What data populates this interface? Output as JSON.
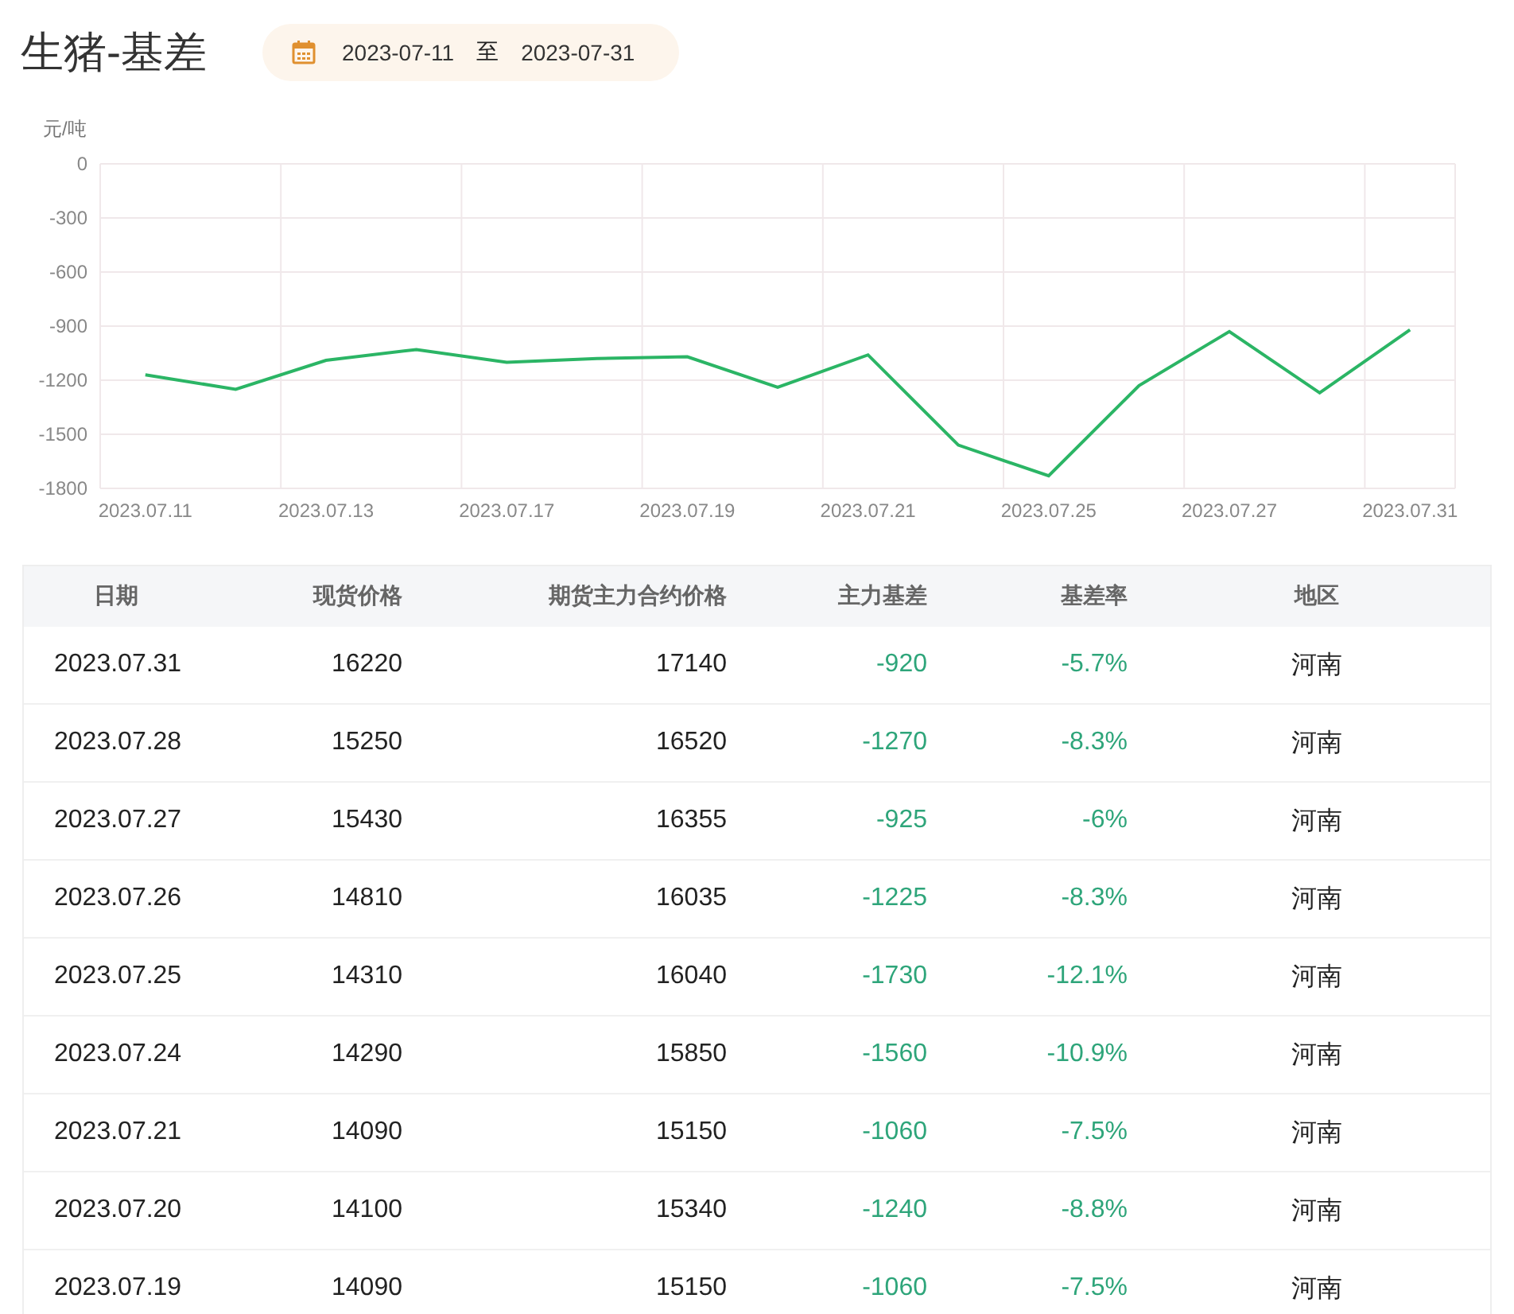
{
  "title": "生猪-基差",
  "date_range": {
    "start": "2023-07-11",
    "separator": "至",
    "end": "2023-07-31"
  },
  "chart": {
    "chart_data": {
      "type": "line",
      "ylabel": "元/吨",
      "categories": [
        "2023.07.11",
        null,
        "2023.07.13",
        null,
        "2023.07.17",
        null,
        "2023.07.19",
        null,
        "2023.07.21",
        null,
        "2023.07.25",
        null,
        "2023.07.27",
        null,
        "2023.07.31"
      ],
      "series": [
        {
          "color": "#2bb565",
          "values": [
            -1170,
            -1250,
            -1090,
            -1030,
            -1100,
            -1080,
            -1070,
            -1240,
            -1060,
            -1560,
            -1730,
            -1230,
            -930,
            -1270,
            -920
          ]
        }
      ],
      "grid": true,
      "ylim": [
        -1800,
        0
      ],
      "yticks": [
        0,
        -300,
        -600,
        -900,
        -1200,
        -1500,
        -1800
      ]
    }
  },
  "table": {
    "columns": [
      "日期",
      "现货价格",
      "期货主力合约价格",
      "主力基差",
      "基差率",
      "地区"
    ],
    "rows": [
      [
        "2023.07.31",
        "16220",
        "17140",
        "-920",
        "-5.7%",
        "河南"
      ],
      [
        "2023.07.28",
        "15250",
        "16520",
        "-1270",
        "-8.3%",
        "河南"
      ],
      [
        "2023.07.27",
        "15430",
        "16355",
        "-925",
        "-6%",
        "河南"
      ],
      [
        "2023.07.26",
        "14810",
        "16035",
        "-1225",
        "-8.3%",
        "河南"
      ],
      [
        "2023.07.25",
        "14310",
        "16040",
        "-1730",
        "-12.1%",
        "河南"
      ],
      [
        "2023.07.24",
        "14290",
        "15850",
        "-1560",
        "-10.9%",
        "河南"
      ],
      [
        "2023.07.21",
        "14090",
        "15150",
        "-1060",
        "-7.5%",
        "河南"
      ],
      [
        "2023.07.20",
        "14100",
        "15340",
        "-1240",
        "-8.8%",
        "河南"
      ],
      [
        "2023.07.19",
        "14090",
        "15150",
        "-1060",
        "-7.5%",
        "河南"
      ]
    ]
  }
}
